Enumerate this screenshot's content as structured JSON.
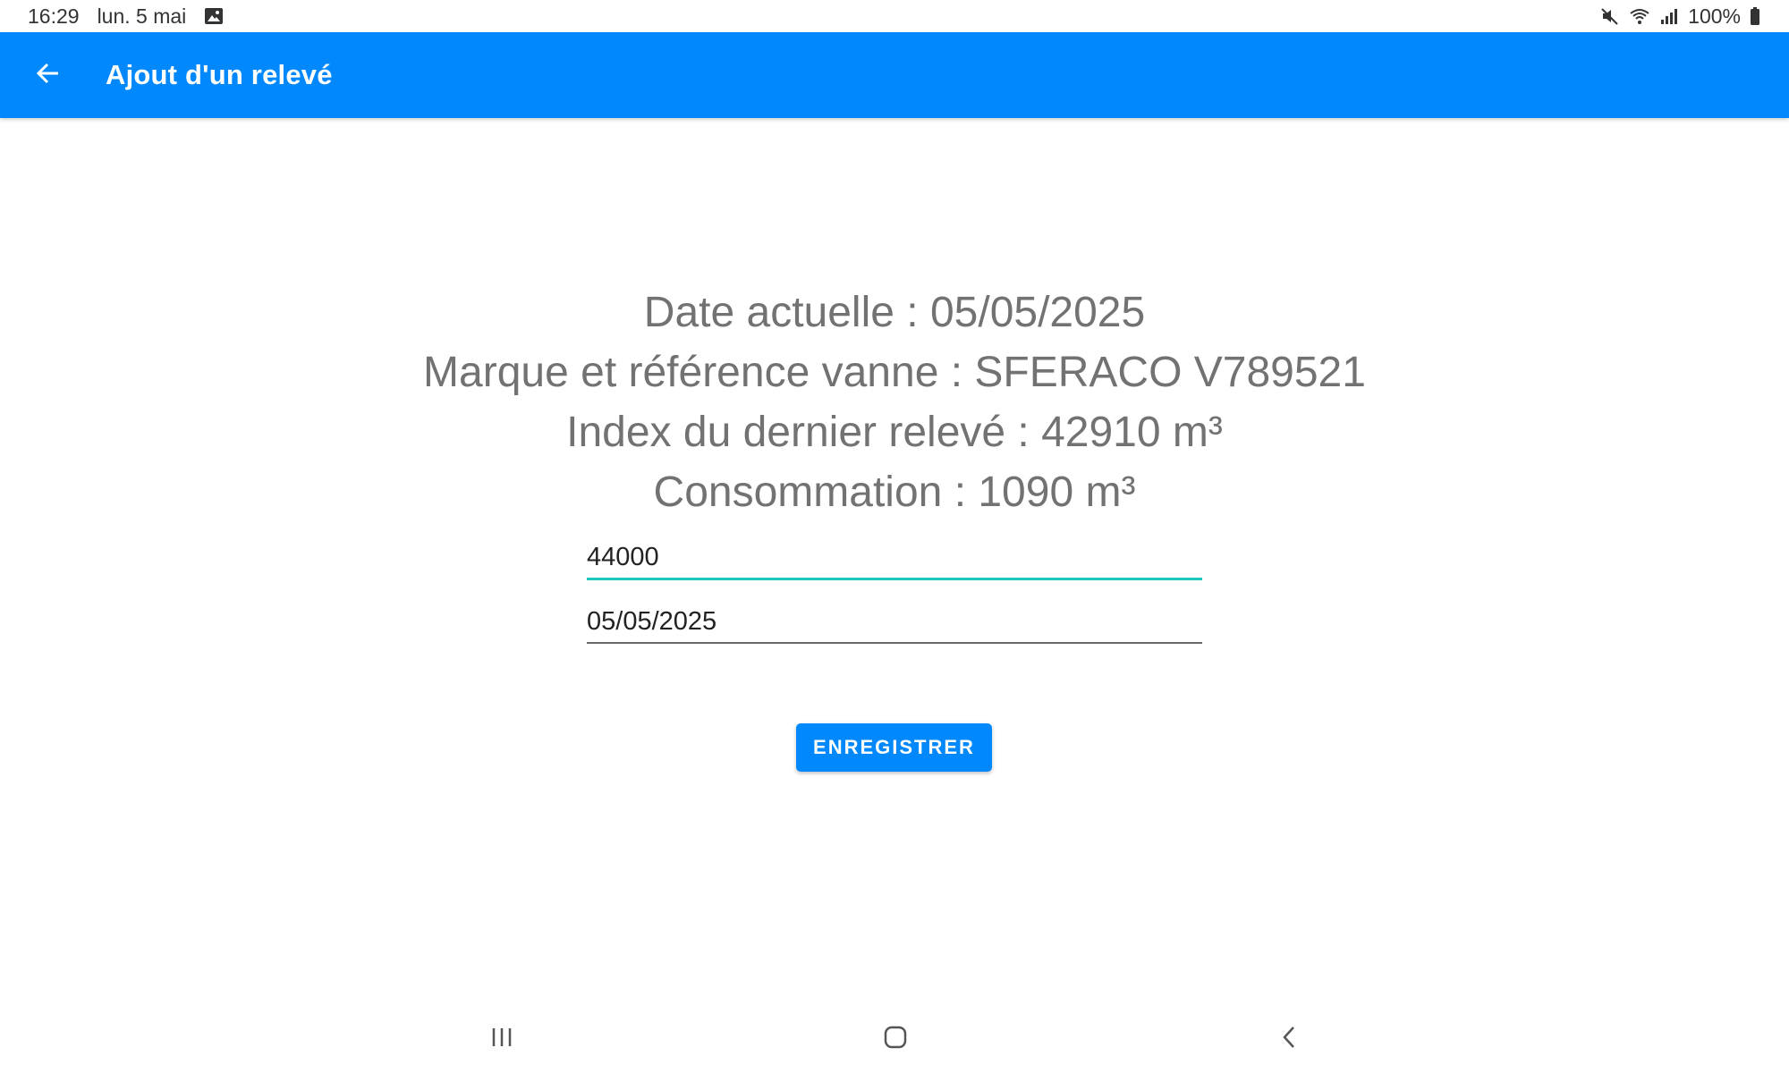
{
  "status_bar": {
    "time": "16:29",
    "date": "lun. 5 mai",
    "battery": "100%",
    "icons": [
      "gallery-icon",
      "mute-icon",
      "wifi-icon",
      "signal-icon",
      "battery-icon"
    ]
  },
  "app_bar": {
    "title": "Ajout d'un relevé",
    "color": "#0088fc",
    "back_icon": "arrow-left-icon"
  },
  "info": {
    "current_date": "Date actuelle : 05/05/2025",
    "valve": "Marque et référence vanne : SFERACO V789521",
    "last_index": "Index du dernier relevé : 42910 m³",
    "consumption": "Consommation : 1090 m³"
  },
  "form": {
    "index_value": "44000",
    "date_value": "05/05/2025",
    "focus_color": "#1ec8c0"
  },
  "actions": {
    "save_label": "ENREGISTRER"
  },
  "nav_bar": {
    "icons": [
      "recent-apps-icon",
      "home-icon",
      "back-icon"
    ]
  }
}
